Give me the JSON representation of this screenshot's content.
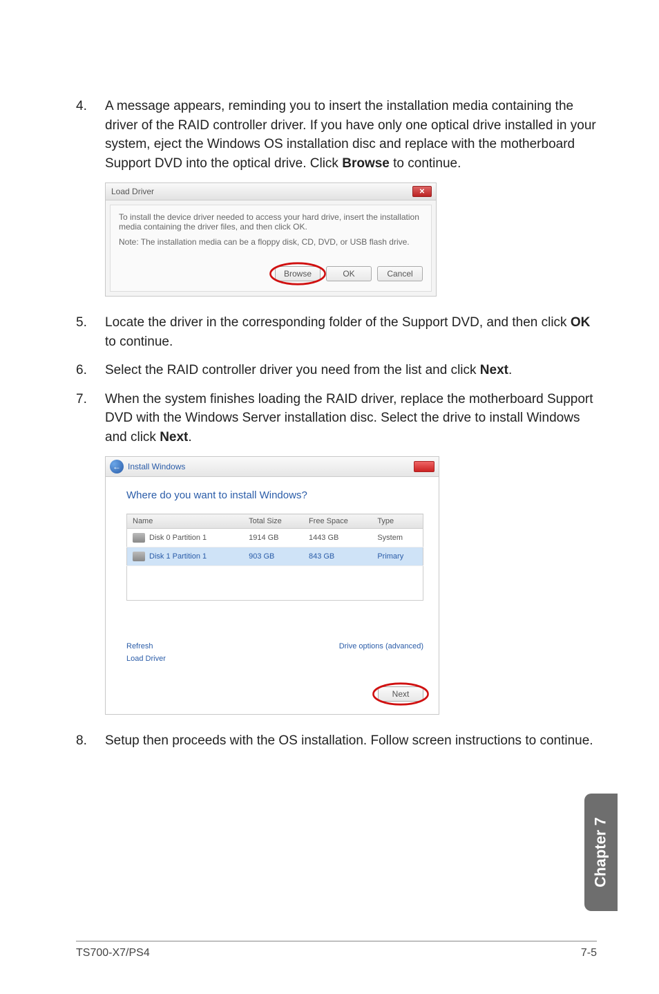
{
  "steps": {
    "s4": {
      "num": "4.",
      "text_a": "A message appears, reminding you to insert the installation media containing the driver of the RAID controller driver. If you have only one optical drive installed in your system, eject the Windows OS installation disc and replace with the motherboard Support DVD into the optical drive. Click ",
      "bold": "Browse",
      "text_b": " to continue."
    },
    "s5": {
      "num": "5.",
      "text_a": "Locate the driver in the corresponding folder of the Support DVD, and then click ",
      "bold": "OK",
      "text_b": " to continue."
    },
    "s6": {
      "num": "6.",
      "text_a": "Select the RAID controller driver you need from the list and click ",
      "bold": "Next",
      "text_b": "."
    },
    "s7": {
      "num": "7.",
      "text_a": "When the system finishes loading the RAID driver, replace the motherboard Support DVD with the Windows Server installation disc. Select the drive to install Windows and click ",
      "bold": "Next",
      "text_b": "."
    },
    "s8": {
      "num": "8.",
      "text_a": "Setup then proceeds with the OS installation. Follow screen instructions to continue.",
      "bold": "",
      "text_b": ""
    }
  },
  "dlg1": {
    "title": "Load Driver",
    "line1": "To install the device driver needed to access your hard drive, insert the installation media containing the driver files, and then click OK.",
    "note": "Note: The installation media can be a floppy disk, CD, DVD, or USB flash drive.",
    "browse": "Browse",
    "ok": "OK",
    "cancel": "Cancel"
  },
  "dlg2": {
    "title": "Install Windows",
    "question": "Where do you want to install Windows?",
    "cols": {
      "name": "Name",
      "total": "Total Size",
      "free": "Free Space",
      "type": "Type"
    },
    "rows": [
      {
        "name": "Disk 0 Partition 1",
        "total": "1914 GB",
        "free": "1443 GB",
        "type": "System"
      },
      {
        "name": "Disk 1 Partition 1",
        "total": "903 GB",
        "free": "843 GB",
        "type": "Primary"
      }
    ],
    "refresh": "Refresh",
    "load": "Load Driver",
    "advanced": "Drive options (advanced)",
    "next": "Next"
  },
  "sidetab": "Chapter 7",
  "footer": {
    "left": "TS700-X7/PS4",
    "right": "7-5"
  }
}
